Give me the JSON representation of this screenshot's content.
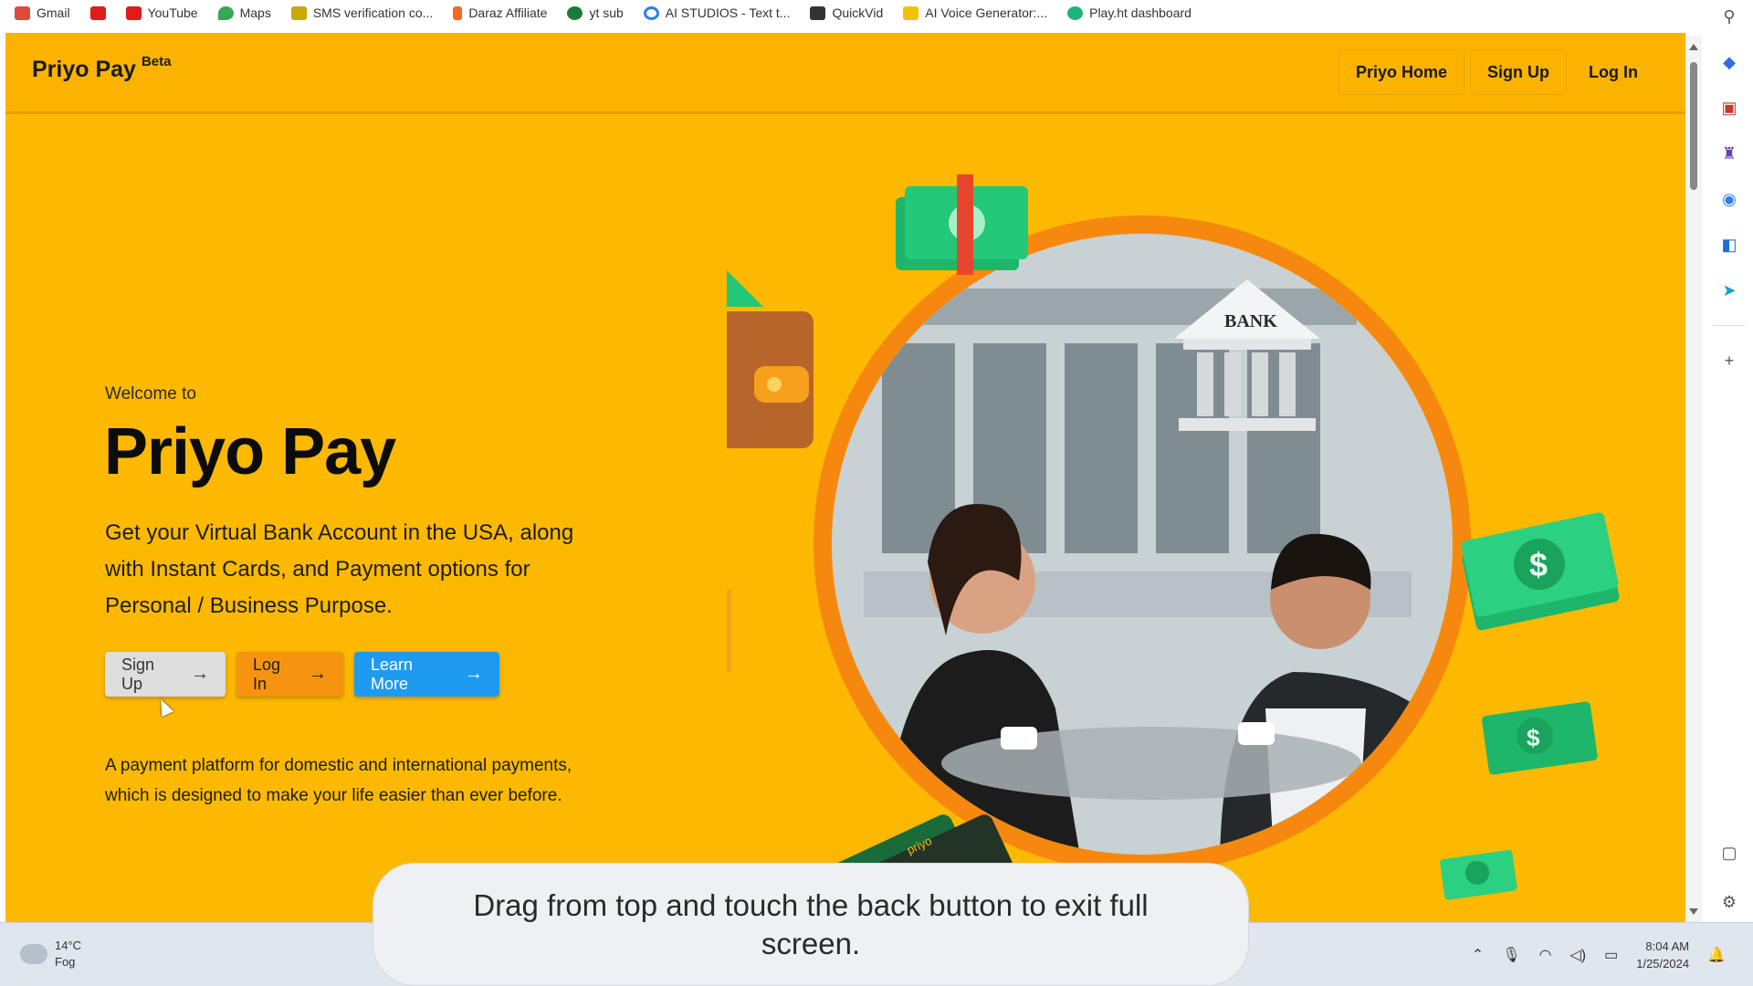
{
  "bookmarks": [
    {
      "label": "Gmail",
      "icon": "gmail-icon",
      "color": "#e04a3a"
    },
    {
      "label": "",
      "icon": "youtube-icon",
      "color": "#e11a1a"
    },
    {
      "label": "YouTube",
      "icon": "youtube-icon",
      "color": "#e11a1a"
    },
    {
      "label": "Maps",
      "icon": "maps-pin-icon",
      "color": "#34a853"
    },
    {
      "label": "SMS verification co...",
      "icon": "sms-icon",
      "color": "#c9a800"
    },
    {
      "label": "Daraz Affiliate",
      "icon": "daraz-icon",
      "color": "#f26a21"
    },
    {
      "label": "yt sub",
      "icon": "ytsub-icon",
      "color": "#1a7a3a"
    },
    {
      "label": "AI STUDIOS - Text t...",
      "icon": "aistudios-icon",
      "color": "#2d7ef0"
    },
    {
      "label": "QuickVid",
      "icon": "quickvid-icon",
      "color": "#333333"
    },
    {
      "label": "AI Voice Generator:...",
      "icon": "voice-icon",
      "color": "#f2c200"
    },
    {
      "label": "Play.ht dashboard",
      "icon": "playht-icon",
      "color": "#1fb37b"
    }
  ],
  "navbar": {
    "brand": "Priyo Pay",
    "beta": "Beta",
    "links": [
      "Priyo Home",
      "Sign Up",
      "Log In"
    ]
  },
  "hero": {
    "welcome": "Welcome to",
    "title": "Priyo Pay",
    "description": "Get your Virtual Bank Account in the USA, along with Instant Cards, and Payment options for Personal / Business Purpose.",
    "buttons": {
      "signup": "Sign Up",
      "login": "Log In",
      "learn": "Learn More"
    },
    "subtext": "A payment platform for domestic and international payments, which is designed to make your life easier than ever before."
  },
  "illustration": {
    "bank_label": "BANK",
    "card_label": "priyo"
  },
  "toast": {
    "message": "Drag from top and touch the back button to exit full screen."
  },
  "taskbar": {
    "weather_temp": "14°C",
    "weather_desc": "Fog",
    "time": "8:04 AM",
    "date": "1/25/2024"
  },
  "colors": {
    "page_bg": "#fcb900",
    "login_btn": "#f7940f",
    "learn_btn": "#1e9bf0",
    "money_green": "#1db66a"
  }
}
